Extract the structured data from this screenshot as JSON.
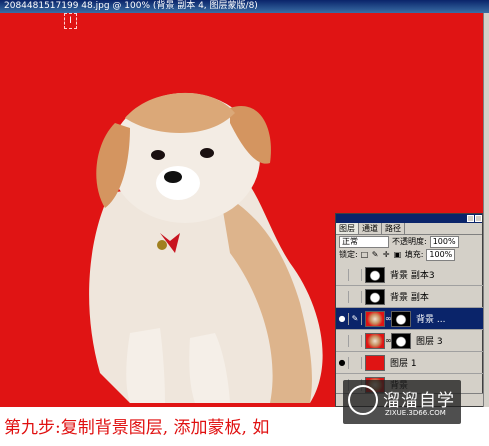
{
  "window": {
    "title": "2084481517199 48.jpg @ 100% (背景 副本 4, 图层蒙版/8)"
  },
  "caption": "第九步:复制背景图层, 添加蒙板, 如",
  "layers_panel": {
    "tabs": [
      "图层",
      "通道",
      "路径"
    ],
    "blend_mode": "正常",
    "opacity_label": "不透明度:",
    "opacity_value": "100%",
    "lock_label": "锁定:",
    "fill_label": "填充:",
    "fill_value": "100%",
    "layers": [
      {
        "name": "背景 副本3",
        "visible": false,
        "selected": false
      },
      {
        "name": "背景 副本",
        "visible": false,
        "selected": false
      },
      {
        "name": "背景 ...",
        "visible": true,
        "selected": true
      },
      {
        "name": "图层 3",
        "visible": false,
        "selected": false
      },
      {
        "name": "图层 1",
        "visible": true,
        "selected": false
      },
      {
        "name": "背景",
        "visible": false,
        "selected": false
      }
    ]
  },
  "watermark": {
    "cn": "溜溜自学",
    "en": "ZIXUE.3D66.COM"
  },
  "colors": {
    "canvas_bg": "#e01414",
    "caption_text": "#e01010",
    "selection": "#0a246a"
  }
}
